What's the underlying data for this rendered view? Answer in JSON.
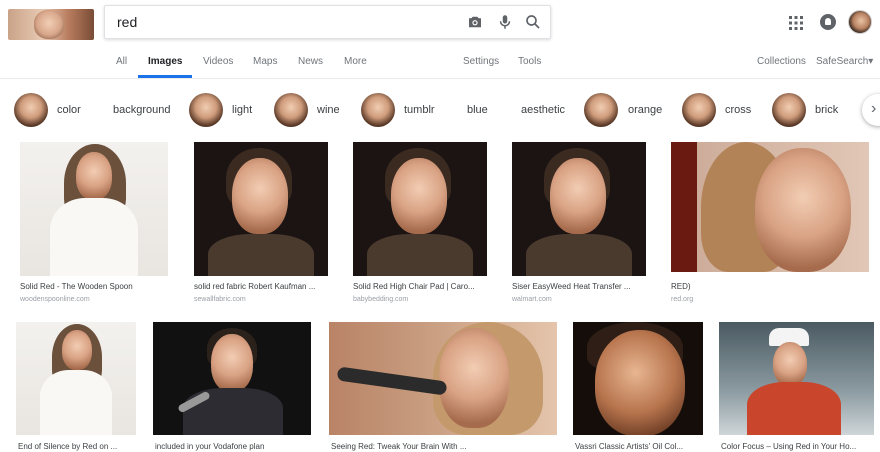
{
  "search": {
    "value": "red"
  },
  "tabs": [
    "All",
    "Images",
    "Videos",
    "Maps",
    "News",
    "More"
  ],
  "tools": [
    "Settings",
    "Tools"
  ],
  "right_links": [
    "Collections",
    "SafeSearch"
  ],
  "safesearch_arrow": "▾",
  "chips": [
    "color",
    "background",
    "light",
    "wine",
    "tumblr",
    "blue",
    "aesthetic",
    "orange",
    "cross",
    "brick"
  ],
  "results": [
    {
      "caption": "Solid Red - The Wooden Spoon",
      "domain": "woodenspoonline.com"
    },
    {
      "caption": "solid red fabric Robert Kaufman ...",
      "domain": "sewallfabric.com"
    },
    {
      "caption": "Solid Red High Chair Pad | Caro...",
      "domain": "babybedding.com"
    },
    {
      "caption": "Siser EasyWeed Heat Transfer ...",
      "domain": "walmart.com"
    },
    {
      "caption": "RED)",
      "domain": "red.org"
    },
    {
      "caption": "End of Silence by Red on ...",
      "domain": ""
    },
    {
      "caption": "included in your Vodafone plan",
      "domain": ""
    },
    {
      "caption": "Seeing Red: Tweak Your Brain With ...",
      "domain": ""
    },
    {
      "caption": "Vassri Classic Artists' Oil Col...",
      "domain": ""
    },
    {
      "caption": "Color Focus – Using Red in Your Ho...",
      "domain": ""
    }
  ],
  "colors": {
    "accent": "#1a73e8",
    "muted": "#70757a"
  },
  "icons": [
    "camera-icon",
    "mic-icon",
    "search-icon",
    "apps-icon",
    "notifications-icon",
    "chevron-right-icon"
  ]
}
